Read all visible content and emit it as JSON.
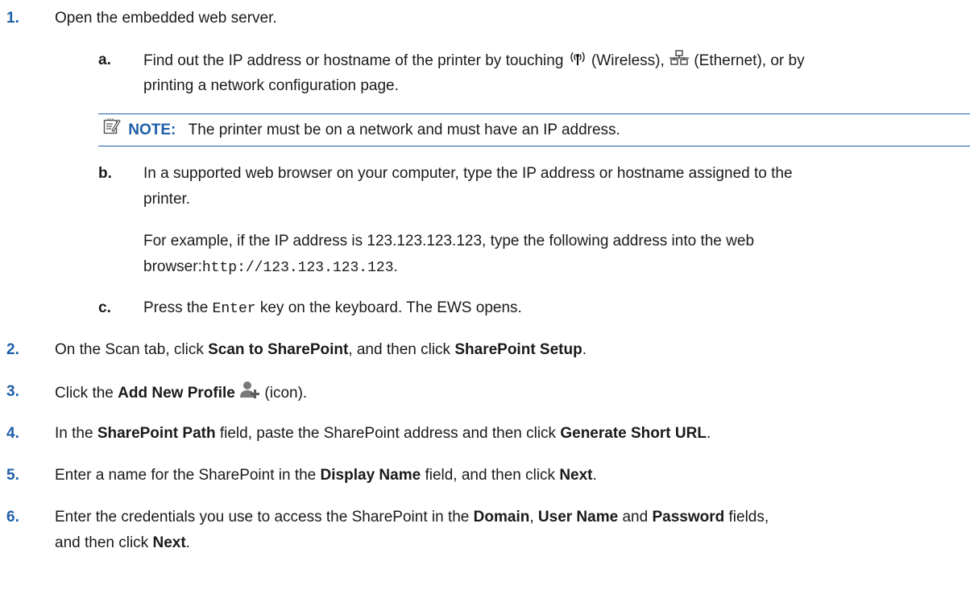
{
  "steps": [
    {
      "num": "1.",
      "text": "Open the embedded web server."
    },
    {
      "num": "2."
    },
    {
      "num": "3."
    },
    {
      "num": "4."
    },
    {
      "num": "5."
    },
    {
      "num": "6."
    }
  ],
  "step1": {
    "a": {
      "letter": "a.",
      "t1": "Find out the IP address or hostname of the printer by touching",
      "t2": "(Wireless),",
      "t3": "(Ethernet), or by",
      "line2": "printing a network configuration page."
    },
    "note": {
      "label": "NOTE:",
      "text": "The printer must be on a network and must have an IP address."
    },
    "b": {
      "letter": "b.",
      "line1": "In a supported web browser on your computer, type the IP address or hostname assigned to the",
      "line2": "printer.",
      "ex1": "For example, if the IP address is 123.123.123.123, type the following address into the web",
      "ex2a": "browser:",
      "ex2code": "http://123.123.123.123",
      "ex2b": "."
    },
    "c": {
      "letter": "c.",
      "t1": "Press the",
      "code": "Enter",
      "t2": "key on the keyboard. The EWS opens."
    }
  },
  "step2": {
    "t1": "On the Scan tab, click",
    "b1": "Scan to SharePoint",
    "t2": ", and then click",
    "b2": "SharePoint Setup",
    "t3": "."
  },
  "step3": {
    "t1": "Click the",
    "b1": "Add New Profile",
    "t2": "(icon)."
  },
  "step4": {
    "t1": "In the",
    "b1": "SharePoint Path",
    "t2": "field, paste the SharePoint address and then click",
    "b2": "Generate Short URL",
    "t3": "."
  },
  "step5": {
    "t1": "Enter a name for the SharePoint in the",
    "b1": "Display Name",
    "t2": "field, and then click",
    "b2": "Next",
    "t3": "."
  },
  "step6": {
    "t1": "Enter the credentials you use to access the SharePoint in the",
    "b1": "Domain",
    "c1": ",",
    "b2": "User Name",
    "t2": "and",
    "b3": "Password",
    "t3": "fields,",
    "line2a": "and then click",
    "line2b": "Next",
    "line2c": "."
  },
  "colors": {
    "accent": "#1f5fa8",
    "text": "#1a1a1a"
  },
  "icons": [
    "wireless-icon",
    "ethernet-icon",
    "note-icon",
    "add-profile-icon"
  ]
}
